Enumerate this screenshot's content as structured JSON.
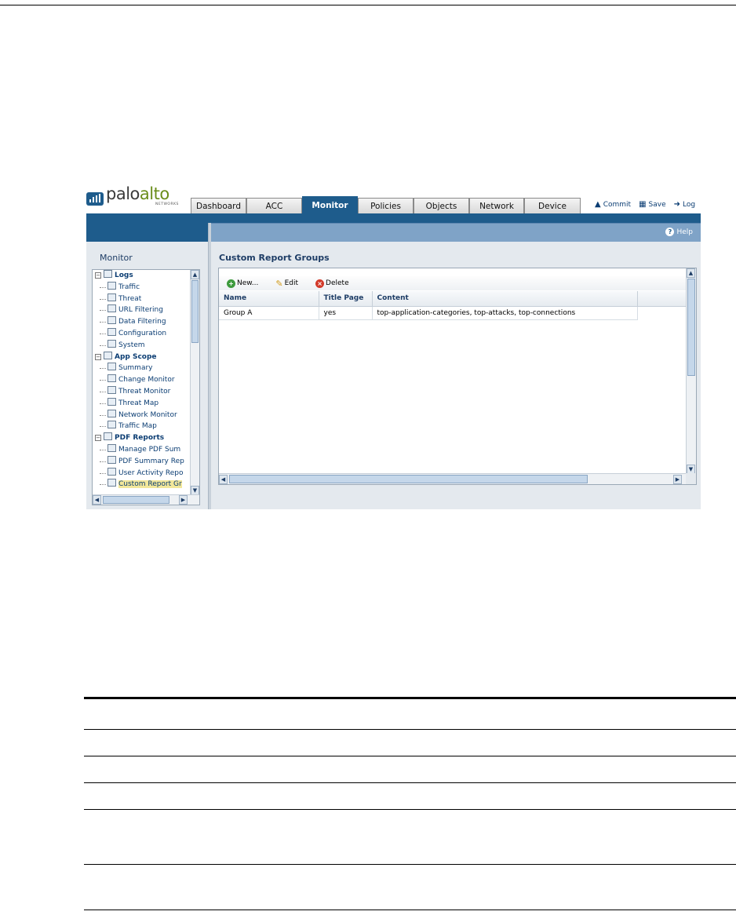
{
  "logo": {
    "part1": "palo",
    "part2": "alto",
    "subtitle": "NETWORKS"
  },
  "tabs": [
    {
      "label": "Dashboard",
      "active": false
    },
    {
      "label": "ACC",
      "active": false
    },
    {
      "label": "Monitor",
      "active": true
    },
    {
      "label": "Policies",
      "active": false
    },
    {
      "label": "Objects",
      "active": false
    },
    {
      "label": "Network",
      "active": false
    },
    {
      "label": "Device",
      "active": false
    }
  ],
  "actions": {
    "commit": "Commit",
    "save": "Save",
    "logout": "Log"
  },
  "help": "Help",
  "sidebar": {
    "title": "Monitor",
    "tree": [
      {
        "label": "Logs",
        "group": true
      },
      {
        "label": "Traffic"
      },
      {
        "label": "Threat"
      },
      {
        "label": "URL Filtering"
      },
      {
        "label": "Data Filtering"
      },
      {
        "label": "Configuration"
      },
      {
        "label": "System"
      },
      {
        "label": "App Scope",
        "group": true
      },
      {
        "label": "Summary"
      },
      {
        "label": "Change Monitor"
      },
      {
        "label": "Threat Monitor"
      },
      {
        "label": "Threat Map"
      },
      {
        "label": "Network Monitor"
      },
      {
        "label": "Traffic Map"
      },
      {
        "label": "PDF Reports",
        "group": true
      },
      {
        "label": "Manage PDF Sum"
      },
      {
        "label": "PDF Summary Rep"
      },
      {
        "label": "User Activity Repo"
      },
      {
        "label": "Custom Report Gr",
        "selected": true
      }
    ]
  },
  "main": {
    "title": "Custom Report Groups",
    "toolbar": {
      "new": "New...",
      "edit": "Edit",
      "delete": "Delete"
    },
    "columns": [
      "Name",
      "Title Page",
      "Content"
    ],
    "rows": [
      [
        "Group A",
        "yes",
        "top-application-categories, top-attacks, top-connections"
      ]
    ]
  }
}
